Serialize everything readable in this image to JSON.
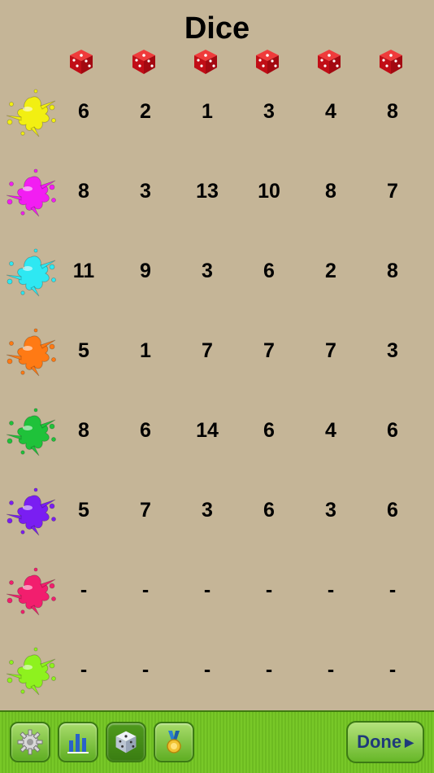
{
  "header": {
    "title": "Dice"
  },
  "rows": [
    {
      "color": "#f2ef12",
      "values": [
        "6",
        "2",
        "1",
        "3",
        "4",
        "8"
      ]
    },
    {
      "color": "#f21ef2",
      "values": [
        "8",
        "3",
        "13",
        "10",
        "8",
        "7"
      ]
    },
    {
      "color": "#2ee8f2",
      "values": [
        "11",
        "9",
        "3",
        "6",
        "2",
        "8"
      ]
    },
    {
      "color": "#ff7a14",
      "values": [
        "5",
        "1",
        "7",
        "7",
        "7",
        "3"
      ]
    },
    {
      "color": "#1fc23a",
      "values": [
        "8",
        "6",
        "14",
        "6",
        "4",
        "6"
      ]
    },
    {
      "color": "#7a1ef2",
      "values": [
        "5",
        "7",
        "3",
        "6",
        "3",
        "6"
      ]
    },
    {
      "color": "#f21e6e",
      "values": [
        "-",
        "-",
        "-",
        "-",
        "-",
        "-"
      ]
    },
    {
      "color": "#8ef21e",
      "values": [
        "-",
        "-",
        "-",
        "-",
        "-",
        "-"
      ]
    }
  ],
  "toolbar": {
    "done_label": "Done",
    "buttons": [
      "gear-icon",
      "bar-chart-icon",
      "dice-icon",
      "medal-icon"
    ]
  },
  "colors": {
    "background": "#c5b597",
    "die": "#d9111b",
    "toolbar": "#78c828",
    "done_text": "#1f3a7a"
  }
}
